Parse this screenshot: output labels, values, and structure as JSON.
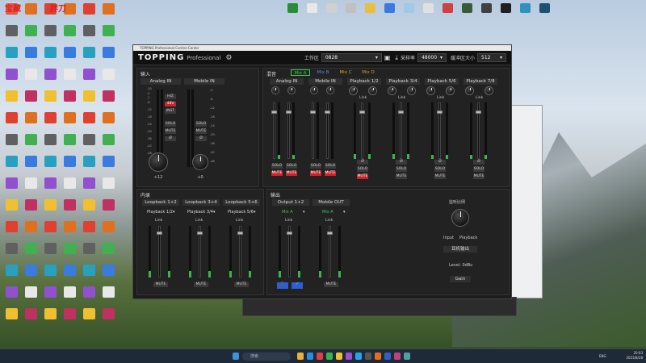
{
  "app": {
    "os_title": "TOPPING Professional Control Center",
    "logo": "TOPPING",
    "logo_sub": "Professional",
    "gear_icon": "gear-icon",
    "workspace_label": "工作区",
    "workspace_value": "0828",
    "samplerate_label": "采样率",
    "samplerate_value": "48000",
    "buffer_label": "缓冲区大小",
    "buffer_value": "512"
  },
  "input": {
    "title": "输入",
    "channels": [
      {
        "label": "Analog IN",
        "value": "+12",
        "btns": [
          "HIZ",
          "48V",
          "INST",
          "SOLO",
          "MUTE",
          "Ø"
        ]
      },
      {
        "label": "Mobile IN",
        "value": "+0",
        "btns": [
          "SOLO",
          "MUTE",
          "Ø"
        ]
      }
    ],
    "scale": [
      "-10",
      "-5",
      "-1",
      "-6",
      "-12",
      "-18",
      "-24",
      "-30",
      "-36",
      "-42",
      "-48"
    ],
    "scale2": [
      "-0",
      "-6",
      "-12",
      "-18",
      "-24",
      "-30",
      "-36",
      "-42",
      "-48"
    ]
  },
  "mixer": {
    "title": "混音",
    "tabs": [
      "Mix A",
      "Mix B",
      "Mix C",
      "Mix D"
    ],
    "channels": [
      "Analog IN",
      "Mobile IN",
      "Playback 1/2",
      "Playback 3/4",
      "Playback 5/6",
      "Playback 7/8"
    ],
    "link": "Link",
    "solo": "SOLO",
    "mute": "MUTE",
    "phase": "Ø"
  },
  "internal": {
    "title": "内录",
    "channels": [
      {
        "label": "Loopback 1+2",
        "source": "Playback 1/2"
      },
      {
        "label": "Loopback 3+4",
        "source": "Playback 3/4"
      },
      {
        "label": "Loopback 5+6",
        "source": "Playback 5/6"
      }
    ],
    "link": "Link",
    "mute": "MUTE"
  },
  "output": {
    "title": "输出",
    "channels": [
      {
        "label": "Output 1+2",
        "source": "Mix A"
      },
      {
        "label": "Mobile OUT",
        "source": "Mix A"
      }
    ],
    "link": "Link",
    "mute": "MUTE",
    "monitor_label": "监听比例",
    "monitor_left": "Input",
    "monitor_right": "Playback",
    "headphone_label": "耳机输出",
    "level": "Level: 0dBu",
    "gain": "Gain"
  },
  "taskbar": {
    "search_placeholder": "搜索",
    "time": "20:03",
    "date": "2023/8/28",
    "lang": "ENG"
  },
  "desktop": {
    "labels": [
      "宝藏",
      "胖刀"
    ]
  }
}
